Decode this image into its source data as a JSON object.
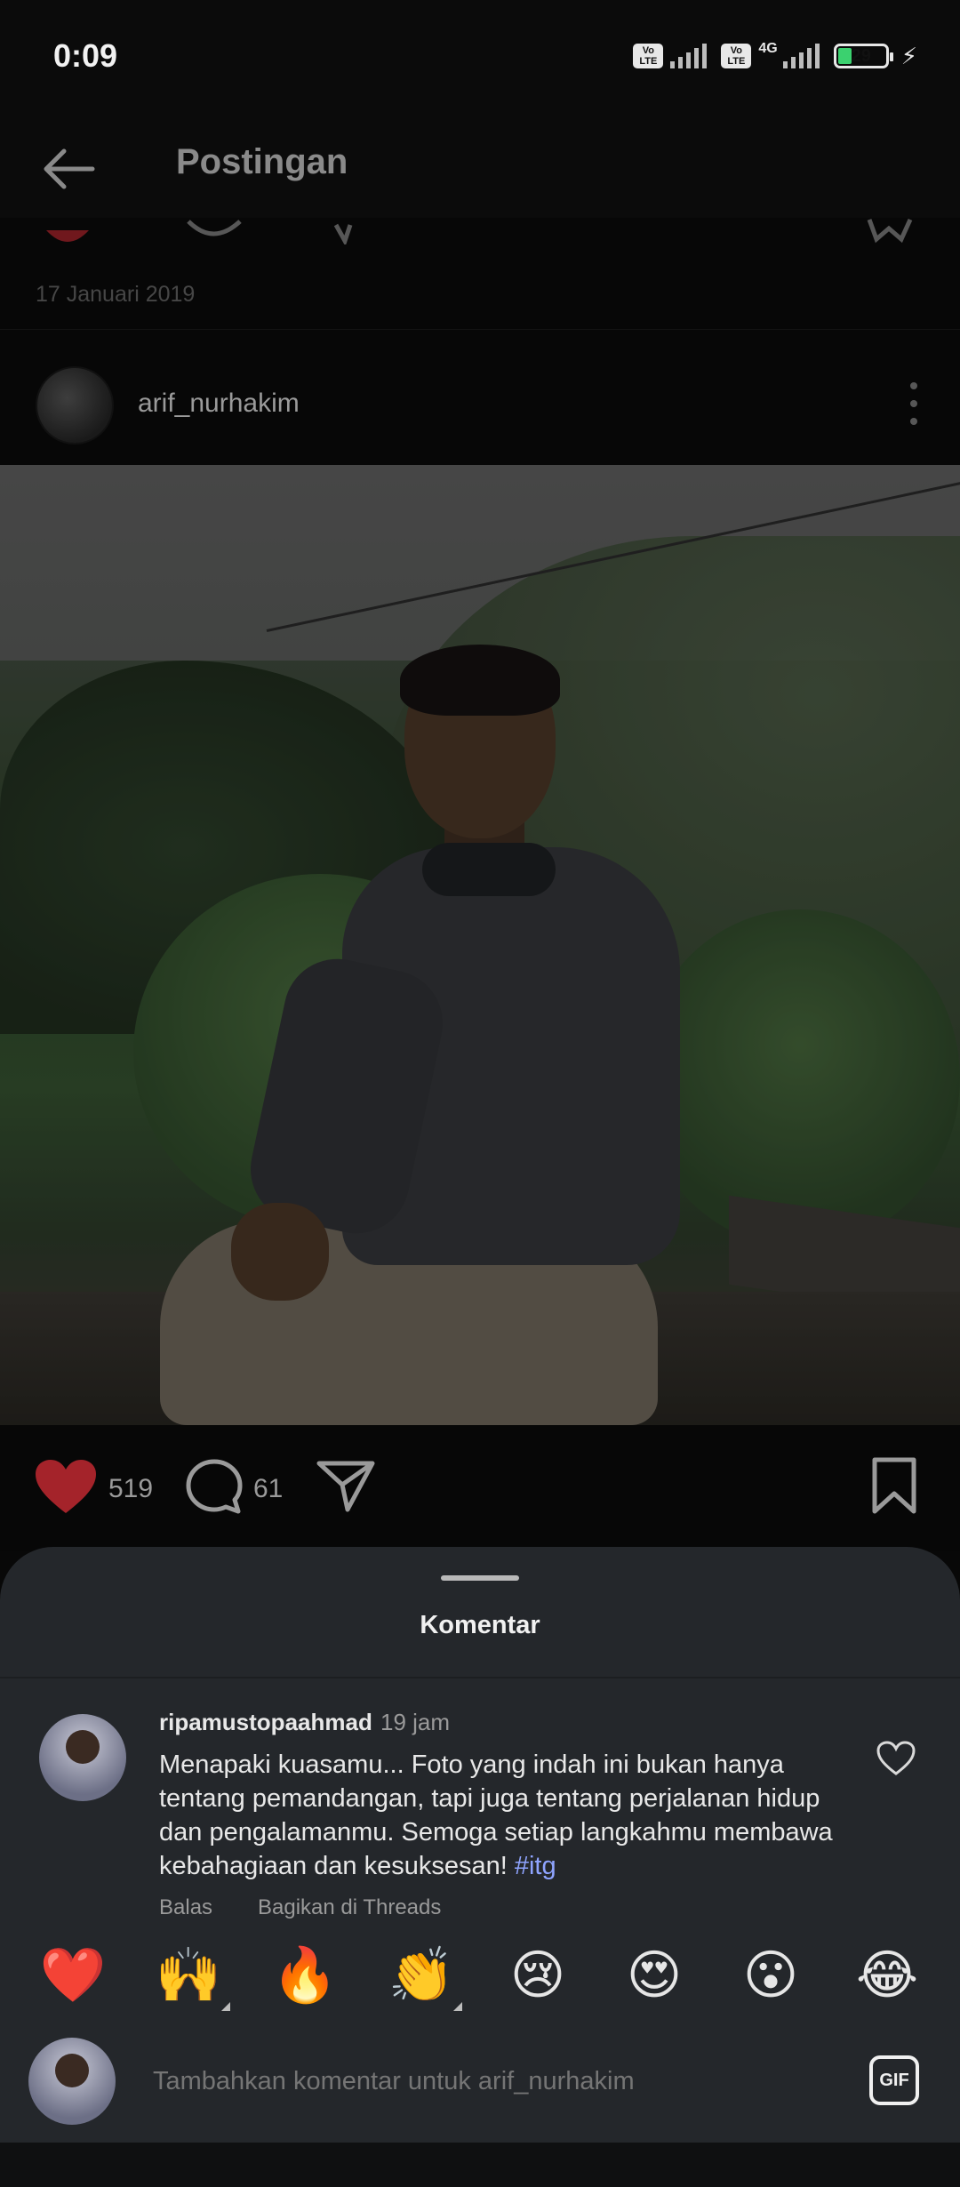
{
  "status_bar": {
    "time": "0:09",
    "volte1": "Vo\nLTE",
    "volte2": "Vo\nLTE",
    "network": "4G",
    "battery": "29",
    "battery_level_percent": 29
  },
  "header": {
    "title": "Postingan"
  },
  "feed": {
    "previous_post_date": "17 Januari 2019",
    "post": {
      "username": "arif_nurhakim",
      "likes": "519",
      "comments": "61"
    }
  },
  "sheet": {
    "title": "Komentar",
    "comment": {
      "username": "ripamustopaahmad",
      "time": "19 jam",
      "text": "Menapaki kuasamu... Foto yang indah ini bukan hanya tentang pemandangan, tapi juga tentang perjalanan hidup dan pengalamanmu. Semoga setiap langkahmu membawa kebahagiaan dan kesuksesan! ",
      "hashtag": "#itg",
      "reply_label": "Balas",
      "share_label": "Bagikan di Threads"
    },
    "emojis": [
      "❤️",
      "🙌",
      "🔥",
      "👏",
      "😢",
      "😍",
      "😮",
      "😂"
    ],
    "input": {
      "placeholder": "Tambahkan komentar untuk arif_nurhakim",
      "gif_label": "GIF"
    }
  },
  "colors": {
    "accent_like": "#c7262f",
    "hashtag": "#8fa4ff",
    "sheet_bg": "#24272b",
    "battery_fill": "#3bd16f"
  }
}
